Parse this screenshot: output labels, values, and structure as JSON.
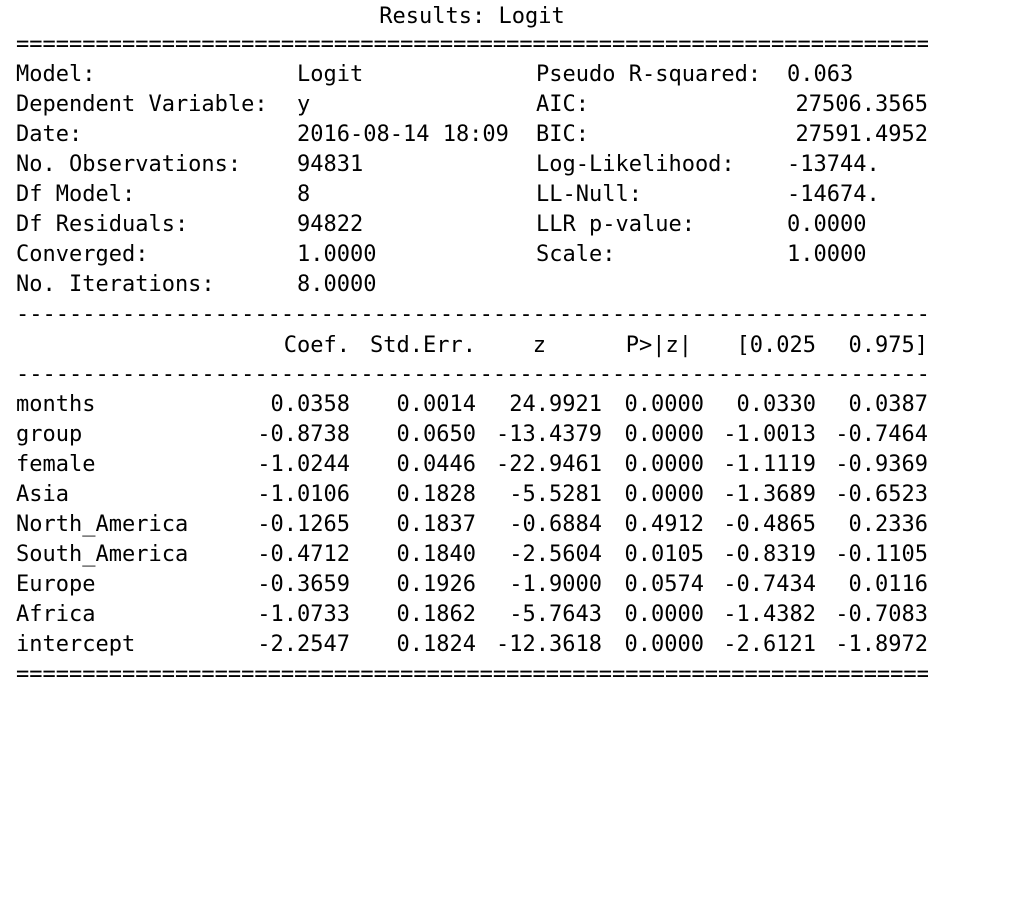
{
  "title": "Results: Logit",
  "rules": {
    "double": "==========================================================================",
    "single": "--------------------------------------------------------------------------"
  },
  "summary": [
    {
      "l_label": "Model:",
      "l_value": "Logit",
      "r_label": "Pseudo R-squared:",
      "r_value": "0.063"
    },
    {
      "l_label": "Dependent Variable:",
      "l_value": "y",
      "r_label": "AIC:",
      "r_value": "27506.3565"
    },
    {
      "l_label": "Date:",
      "l_value": "2016-08-14 18:09",
      "r_label": "BIC:",
      "r_value": "27591.4952"
    },
    {
      "l_label": "No. Observations:",
      "l_value": "94831",
      "r_label": "Log-Likelihood:",
      "r_value": "-13744."
    },
    {
      "l_label": "Df Model:",
      "l_value": "8",
      "r_label": "LL-Null:",
      "r_value": "-14674."
    },
    {
      "l_label": "Df Residuals:",
      "l_value": "94822",
      "r_label": "LLR p-value:",
      "r_value": "0.0000"
    },
    {
      "l_label": "Converged:",
      "l_value": "1.0000",
      "r_label": "Scale:",
      "r_value": "1.0000"
    },
    {
      "l_label": "No. Iterations:",
      "l_value": "8.0000",
      "r_label": "",
      "r_value": ""
    }
  ],
  "columns": [
    "Coef.",
    "Std.Err.",
    "z",
    "P>|z|",
    "[0.025",
    "0.975]"
  ],
  "coefficients": [
    {
      "name": "months",
      "values": [
        "0.0358",
        "0.0014",
        "24.9921",
        "0.0000",
        "0.0330",
        "0.0387"
      ]
    },
    {
      "name": "group",
      "values": [
        "-0.8738",
        "0.0650",
        "-13.4379",
        "0.0000",
        "-1.0013",
        "-0.7464"
      ]
    },
    {
      "name": "female",
      "values": [
        "-1.0244",
        "0.0446",
        "-22.9461",
        "0.0000",
        "-1.1119",
        "-0.9369"
      ]
    },
    {
      "name": "Asia",
      "values": [
        "-1.0106",
        "0.1828",
        "-5.5281",
        "0.0000",
        "-1.3689",
        "-0.6523"
      ]
    },
    {
      "name": "North_America",
      "values": [
        "-0.1265",
        "0.1837",
        "-0.6884",
        "0.4912",
        "-0.4865",
        "0.2336"
      ]
    },
    {
      "name": "South_America",
      "values": [
        "-0.4712",
        "0.1840",
        "-2.5604",
        "0.0105",
        "-0.8319",
        "-0.1105"
      ]
    },
    {
      "name": "Europe",
      "values": [
        "-0.3659",
        "0.1926",
        "-1.9000",
        "0.0574",
        "-0.7434",
        "0.0116"
      ]
    },
    {
      "name": "Africa",
      "values": [
        "-1.0733",
        "0.1862",
        "-5.7643",
        "0.0000",
        "-1.4382",
        "-0.7083"
      ]
    },
    {
      "name": "intercept",
      "values": [
        "-2.2547",
        "0.1824",
        "-12.3618",
        "0.0000",
        "-2.6121",
        "-1.8972"
      ]
    }
  ]
}
